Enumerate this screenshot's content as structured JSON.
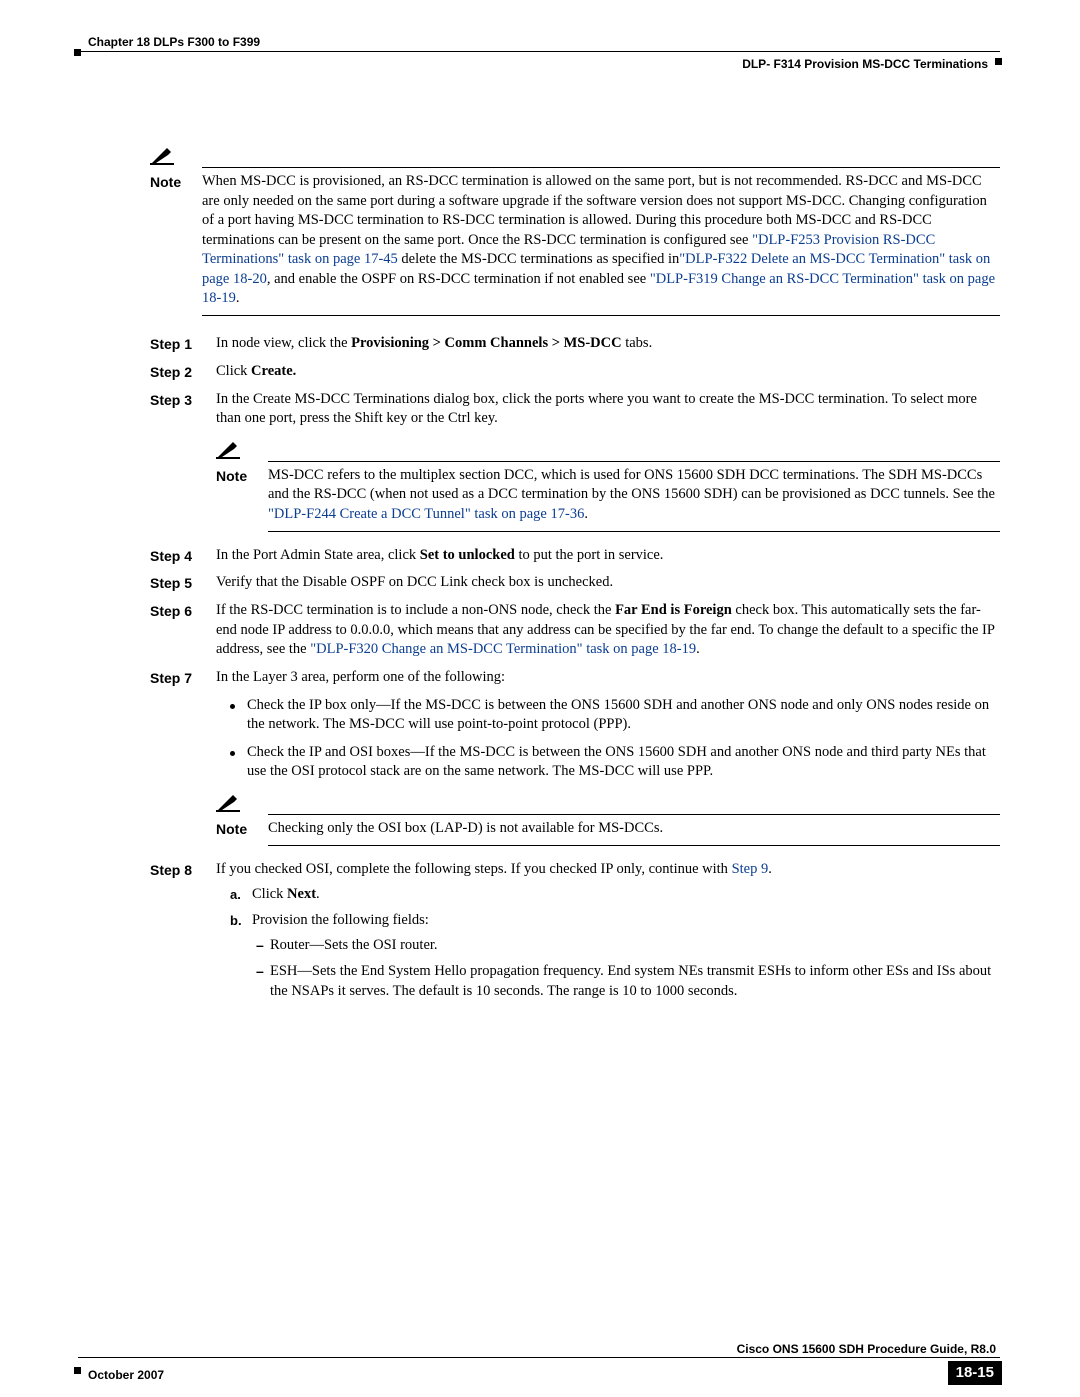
{
  "header": {
    "chapter": "Chapter 18 DLPs F300 to F399",
    "section": "DLP- F314 Provision MS-DCC Terminations"
  },
  "notes": {
    "label": "Note",
    "main_a": "When MS-DCC is provisioned, an RS-DCC termination is allowed on the same port, but is not recommended. RS-DCC and MS-DCC are only needed on the same port during a software upgrade if the software version does not support MS-DCC. Changing configuration of a port having MS-DCC termination to RS-DCC termination is allowed. During this procedure both MS-DCC and RS-DCC terminations can be present on the same port. Once the RS-DCC termination is configured see ",
    "main_link1": "\"DLP-F253 Provision RS-DCC Terminations\" task on page 17-45",
    "main_b": " delete the MS-DCC terminations as specified in",
    "main_link2": "\"DLP-F322 Delete an MS-DCC Termination\" task on page 18-20",
    "main_c": ", and enable the OSPF on RS-DCC termination if not enabled see ",
    "main_link3": "\"DLP-F319 Change an RS-DCC Termination\" task on page 18-19",
    "main_d": ".",
    "step3_a": "MS-DCC refers to the multiplex section DCC, which is used for ONS 15600 SDH DCC terminations. The SDH MS-DCCs and the RS-DCC (when not used as a DCC termination by the ONS 15600 SDH) can be provisioned as DCC tunnels. See the ",
    "step3_link": "\"DLP-F244 Create a DCC Tunnel\" task on page 17-36",
    "step3_b": ".",
    "step7": "Checking only the OSI box (LAP-D) is not available for MS-DCCs."
  },
  "steps": {
    "s1_label": "Step 1",
    "s1_a": "In node view, click the ",
    "s1_bold": "Provisioning > Comm Channels > MS-DCC",
    "s1_b": " tabs.",
    "s2_label": "Step 2",
    "s2_a": "Click ",
    "s2_bold": "Create.",
    "s3_label": "Step 3",
    "s3": "In the Create MS-DCC Terminations dialog box, click the ports where you want to create the MS-DCC termination. To select more than one port, press the Shift key or the Ctrl key.",
    "s4_label": "Step 4",
    "s4_a": "In the Port Admin State area, click ",
    "s4_bold": "Set to unlocked",
    "s4_b": " to put the port in service.",
    "s5_label": "Step 5",
    "s5": "Verify that the Disable OSPF on DCC Link check box is unchecked.",
    "s6_label": "Step 6",
    "s6_a": "If the RS-DCC termination is to include a non-ONS node, check the ",
    "s6_bold": "Far End is Foreign",
    "s6_b": " check box. This automatically sets the far-end node IP address to 0.0.0.0, which means that any address can be specified by the far end. To change the default to a specific the IP address, see the ",
    "s6_link": "\"DLP-F320 Change an MS-DCC Termination\" task on page 18-19",
    "s6_c": ".",
    "s7_label": "Step 7",
    "s7_intro": "In the Layer 3 area, perform one of the following:",
    "s7_b1": "Check the IP box only—If the MS-DCC is between the ONS 15600 SDH and another ONS node and only ONS nodes reside on the network. The MS-DCC will use point-to-point protocol (PPP).",
    "s7_b2": "Check the IP and OSI boxes—If the MS-DCC is between the ONS 15600 SDH and another ONS node and third party NEs that use the OSI protocol stack are on the same network. The MS-DCC will use PPP.",
    "s8_label": "Step 8",
    "s8_a": "If you checked OSI, complete the following steps. If you checked IP only, continue with ",
    "s8_link": "Step 9",
    "s8_b": ".",
    "s8_sub_a_lbl": "a.",
    "s8_sub_a_a": "Click ",
    "s8_sub_a_bold": "Next",
    "s8_sub_a_b": ".",
    "s8_sub_b_lbl": "b.",
    "s8_sub_b": "Provision the following fields:",
    "s8_dash1": "Router—Sets the OSI router.",
    "s8_dash2": "ESH—Sets the End System Hello propagation frequency. End system NEs transmit ESHs to inform other ESs and ISs about the NSAPs it serves. The default is 10 seconds. The range is 10 to 1000 seconds."
  },
  "footer": {
    "guide": "Cisco ONS 15600 SDH Procedure Guide, R8.0",
    "date": "October 2007",
    "page": "18-15"
  }
}
